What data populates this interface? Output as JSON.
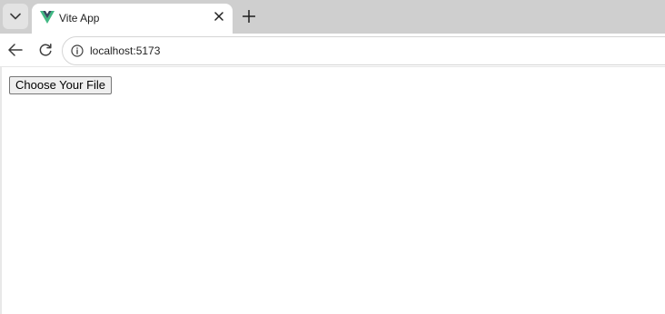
{
  "browser": {
    "tab": {
      "title": "Vite App",
      "favicon": "vue-logo-icon"
    },
    "address_bar": {
      "url": "localhost:5173"
    },
    "colors": {
      "tabstrip": "#cfcfcf",
      "vue_green": "#41b883",
      "vue_dark": "#34495e"
    }
  },
  "page": {
    "file_button_label": "Choose Your File"
  }
}
